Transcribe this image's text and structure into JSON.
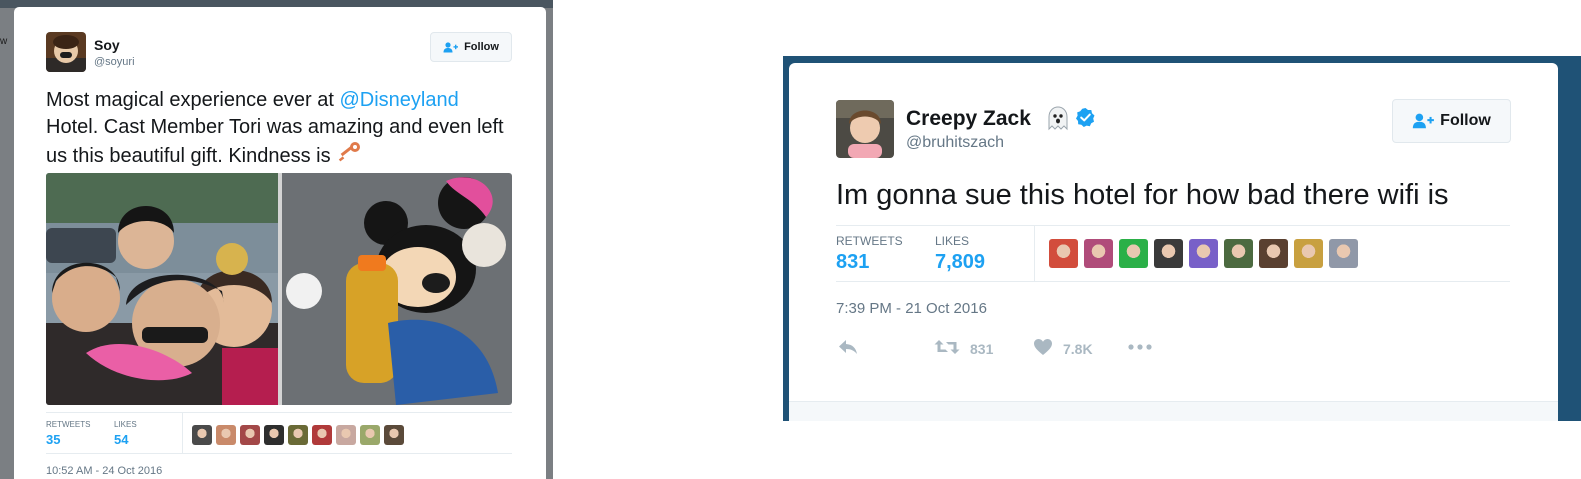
{
  "left_tweet": {
    "author": {
      "name": "Soy",
      "handle": "@soyuri"
    },
    "follow_label": "Follow",
    "text": {
      "part1": "Most magical experience ever at ",
      "mention": "@Disneyland",
      "part2": " Hotel. Cast Member Tori was amazing and even left us this beautiful gift. Kindness is "
    },
    "stats": {
      "retweets_label": "RETWEETS",
      "retweets": "35",
      "likes_label": "LIKES",
      "likes": "54"
    },
    "timestamp": "10:52 AM - 24 Oct 2016",
    "liker_count": 9
  },
  "right_tweet": {
    "author": {
      "name": "Creepy Zack",
      "handle": "@bruhitszach",
      "verified": true,
      "emoji": "ghost-icon"
    },
    "follow_label": "Follow",
    "text": "Im gonna sue this hotel for how bad there wifi is",
    "stats": {
      "retweets_label": "RETWEETS",
      "retweets": "831",
      "likes_label": "LIKES",
      "likes": "7,809"
    },
    "timestamp": "7:39 PM - 21 Oct 2016",
    "actions": {
      "reply_icon": "reply-icon",
      "retweet_count": "831",
      "like_count": "7.8K",
      "more_icon": "more-icon"
    },
    "liker_count": 9
  },
  "colors": {
    "accent": "#1da1f2",
    "text": "#14171a",
    "muted": "#657786",
    "verified": "#1da1f2",
    "left_backdrop": "#7b7f83",
    "right_backdrop": "#1f5276"
  }
}
